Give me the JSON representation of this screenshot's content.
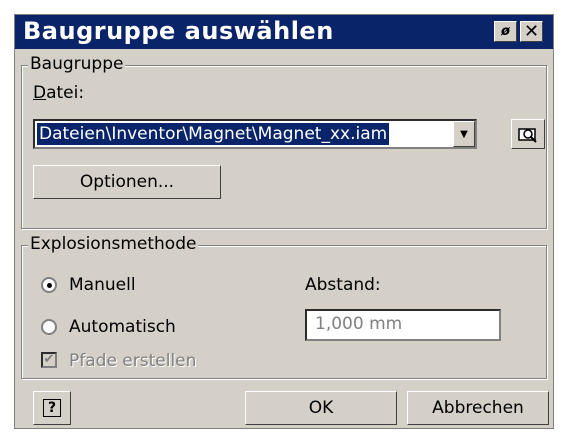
{
  "window": {
    "title": "Baugruppe auswählen",
    "pin_glyph": "ø",
    "close_glyph": "✕"
  },
  "group_baugruppe": {
    "legend": "Baugruppe",
    "datei_label": "Datei:",
    "file_value": "Dateien\\Inventor\\Magnet\\Magnet_xx.iam",
    "options_button": "Optionen..."
  },
  "group_explosion": {
    "legend": "Explosionsmethode",
    "radio_manual": "Manuell",
    "radio_auto": "Automatisch",
    "selected_method": "Manuell",
    "checkbox_paths": "Pfade erstellen",
    "checkbox_paths_checked": true,
    "abstand_label": "Abstand:",
    "abstand_value": "1,000 mm"
  },
  "footer": {
    "help_glyph": "?",
    "ok_button": "OK",
    "cancel_button": "Abbrechen"
  },
  "colors": {
    "title_bar": "#0a246a",
    "face": "#d4d0c8",
    "selection": "#0a246a"
  }
}
